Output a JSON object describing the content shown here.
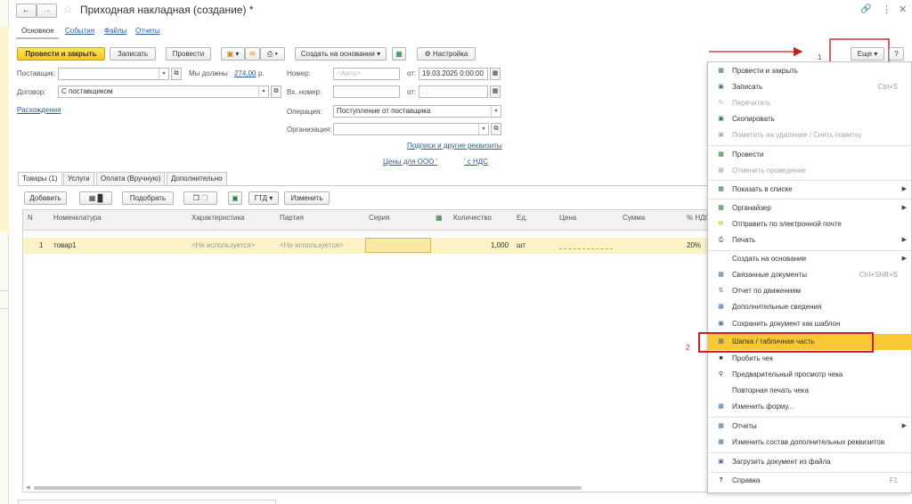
{
  "window": {
    "title": "Приходная накладная (создание) *"
  },
  "nav_tabs": [
    "Основное",
    "События",
    "Файлы",
    "Отчеты"
  ],
  "toolbar": {
    "post_close": "Провести и закрыть",
    "write": "Записать",
    "post": "Провести",
    "create_based": "Создать на основании",
    "settings": "Настройка",
    "more": "Еще",
    "help": "?"
  },
  "header": {
    "supplier_label": "Поставщик:",
    "owe_text": "Мы должны",
    "owe_amount": "274,00",
    "owe_currency": "р.",
    "contract_label": "Договор:",
    "contract_value": "С поставщиком",
    "discrepancies_link": "Расхождения",
    "number_label": "Номер:",
    "number_placeholder": "<Авто>",
    "date_from_label": "от:",
    "date_value": "19.03.2025  0:00:00",
    "in_number_label": "Вх. номер:",
    "in_date_from_label": "от:",
    "in_date_value": " .  .",
    "operation_label": "Операция:",
    "operation_value": "Поступление от поставщика",
    "organization_label": "Организация:",
    "signatures_link": "Подписи и другие реквизиты",
    "prices_link": "Цены для ООО '",
    "vat_link": "' с НДС"
  },
  "doc_tabs": [
    "Товары (1)",
    "Услуги",
    "Оплата (Вручную)",
    "Дополнительно"
  ],
  "table_toolbar": {
    "add": "Добавить",
    "pick": "Подобрать",
    "gtd": "ГТД",
    "change": "Изменить"
  },
  "table": {
    "columns": [
      "N",
      "Номенклатура",
      "Характеристика",
      "Партия",
      "Серия",
      "Количество",
      "Ед.",
      "Цена",
      "Сумма",
      "% НДС"
    ],
    "rows": [
      {
        "n": "1",
        "item": "товар1",
        "characteristic": "<Не используется>",
        "batch": "<Не используется>",
        "series": "",
        "qty": "1,000",
        "unit": "шт",
        "price": "",
        "sum": "",
        "vat": "20%"
      }
    ]
  },
  "menu": {
    "items": [
      {
        "label": "Провести и закрыть",
        "icon": "post-close-icon"
      },
      {
        "label": "Записать",
        "shortcut": "Ctrl+S",
        "icon": "save-icon"
      },
      {
        "label": "Перечитать",
        "disabled": true,
        "icon": "reload-icon"
      },
      {
        "label": "Скопировать",
        "icon": "copy-icon"
      },
      {
        "label": "Пометить на удаление / Снять пометку",
        "disabled": true,
        "icon": "delete-mark-icon"
      },
      {
        "label": "Провести",
        "icon": "post-icon"
      },
      {
        "label": "Отменить проведение",
        "disabled": true,
        "icon": "unpost-icon"
      },
      {
        "label": "Показать в списке",
        "submenu": true,
        "icon": "show-list-icon"
      },
      {
        "label": "Органайзер",
        "submenu": true,
        "icon": "organizer-icon"
      },
      {
        "label": "Отправить по электронной почте",
        "icon": "email-icon"
      },
      {
        "label": "Печать",
        "submenu": true,
        "icon": "print-icon"
      },
      {
        "label": "Создать на основании",
        "submenu": true
      },
      {
        "label": "Связанные документы",
        "shortcut": "Ctrl+Shift+S",
        "icon": "related-docs-icon"
      },
      {
        "label": "Отчет по движениям",
        "icon": "movements-icon"
      },
      {
        "label": "Дополнительные сведения",
        "icon": "info-icon"
      },
      {
        "label": "Сохранить документ как шаблон",
        "icon": "template-icon"
      },
      {
        "label": "Шапка / табличная часть",
        "highlighted": true,
        "icon": "header-table-icon"
      },
      {
        "label": "Пробить чек",
        "icon": "receipt-icon"
      },
      {
        "label": "Предварительный просмотр чека",
        "icon": "preview-icon"
      },
      {
        "label": "Повторная печать чека"
      },
      {
        "label": "Изменить форму...",
        "icon": "form-icon"
      },
      {
        "label": "Отчеты",
        "submenu": true,
        "icon": "reports-icon"
      },
      {
        "label": "Изменить состав дополнительных реквизитов",
        "icon": "attributes-icon"
      },
      {
        "label": "Загрузить документ из файла",
        "icon": "load-file-icon"
      },
      {
        "label": "Справка",
        "shortcut": "F1",
        "icon": "help-icon"
      }
    ]
  },
  "annotations": {
    "step1": "1",
    "step2": "2"
  },
  "colors": {
    "accent": "#f3c61c",
    "annotation_red": "#cc1f1f",
    "link": "#2a5d9f"
  }
}
